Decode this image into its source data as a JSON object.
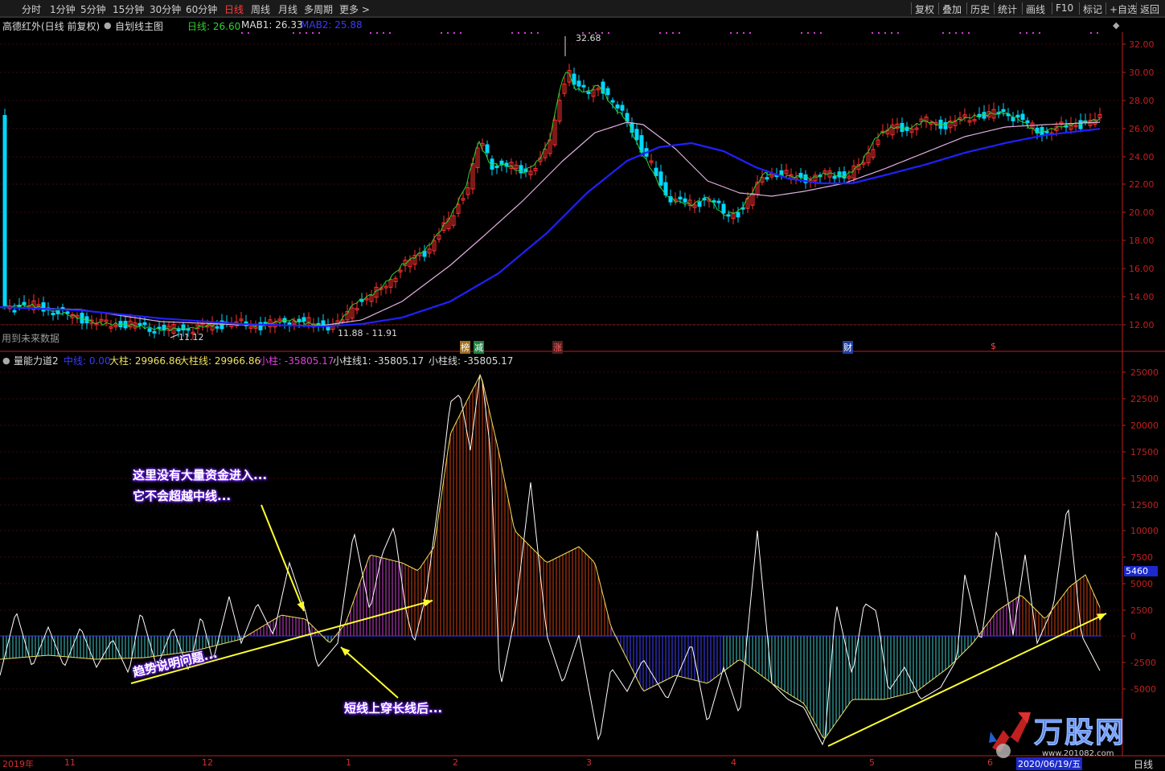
{
  "toolbar": {
    "periods": [
      "分时",
      "1分钟",
      "5分钟",
      "15分钟",
      "30分钟",
      "60分钟",
      "日线",
      "周线",
      "月线",
      "多周期",
      "更多 >"
    ],
    "active_period": "日线",
    "actions": [
      "复权",
      "叠加",
      "历史",
      "统计",
      "画线",
      "F10",
      "标记",
      "+自选",
      "返回"
    ]
  },
  "main_panel": {
    "stock_title": "高德红外(日线 前复权)",
    "template_label": "自划线主图",
    "legend": [
      {
        "label": "日线: 26.60",
        "color": "#2fd12f"
      },
      {
        "label": "MAB1: 26.33",
        "color": "#dcdcdc"
      },
      {
        "label": "MAB2: 25.88",
        "color": "#3a3aff"
      }
    ],
    "y_ticks": [
      "32.00",
      "30.00",
      "28.00",
      "26.00",
      "24.00",
      "22.00",
      "20.00",
      "18.00",
      "16.00",
      "14.00",
      "12.00"
    ],
    "annotations": {
      "high": "32.68",
      "low": "11.12",
      "range": "11.88 - 11.91",
      "future_note": "用到未来数据"
    },
    "event_markers": [
      "榜",
      "减",
      "涨",
      "财",
      "$"
    ]
  },
  "sub_panel": {
    "indicator_name": "量能力道2",
    "legend": [
      {
        "label": "中线: 0.00",
        "color": "#3a3aff"
      },
      {
        "label": "大柱: 29966.86",
        "color": "#f0e060"
      },
      {
        "label": "大柱线: 29966.86",
        "color": "#f0e060"
      },
      {
        "label": "小柱: -35805.17",
        "color": "#e040e0"
      },
      {
        "label": "小柱线1: -35805.17",
        "color": "#dcdcdc"
      },
      {
        "label": "小柱线: -35805.17",
        "color": "#dcdcdc"
      }
    ],
    "y_ticks": [
      "25000",
      "22500",
      "20000",
      "17500",
      "15000",
      "12500",
      "10000",
      "7500",
      "5000",
      "2500",
      "0",
      "-2500",
      "-5000"
    ],
    "current_value": "5460",
    "callouts": [
      "这里没有大量资金进入...",
      "它不会超越中线...",
      "趋势说明问题...",
      "短线上穿长线后..."
    ]
  },
  "time_axis": {
    "labels": [
      "2019年",
      "11",
      "12",
      "1",
      "2",
      "3",
      "4",
      "5",
      "6"
    ],
    "current_date": "2020/06/19/五",
    "period_label": "日线"
  },
  "watermark": {
    "brand": "万股网",
    "url": "www.201082.com"
  },
  "colors": {
    "up": "#ff3030",
    "down": "#00d8ff",
    "ma_short": "#2fd12f",
    "ma1": "#e0b0e0",
    "ma2": "#2020ff",
    "axis": "#c02020"
  }
}
